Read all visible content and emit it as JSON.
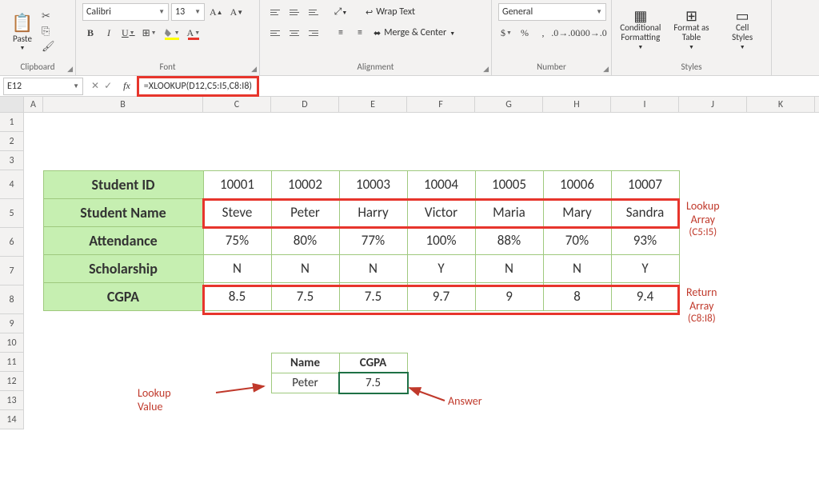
{
  "ribbon": {
    "clipboard": {
      "paste": "Paste",
      "label": "Clipboard"
    },
    "font": {
      "name": "Calibri",
      "size": "13",
      "bold": "B",
      "italic": "I",
      "underline": "U",
      "label": "Font"
    },
    "alignment": {
      "wrap": "Wrap Text",
      "merge": "Merge & Center",
      "label": "Alignment"
    },
    "number": {
      "format": "General",
      "label": "Number"
    },
    "styles": {
      "cond": "Conditional\nFormatting",
      "table": "Format as\nTable",
      "cell": "Cell\nStyles",
      "label": "Styles"
    }
  },
  "namebox": "E12",
  "formula": "=XLOOKUP(D12,C5:I5,C8:I8)",
  "columns": [
    "A",
    "B",
    "C",
    "D",
    "E",
    "F",
    "G",
    "H",
    "I",
    "J",
    "K"
  ],
  "rows": [
    "1",
    "2",
    "3",
    "4",
    "5",
    "6",
    "7",
    "8",
    "9",
    "10",
    "11",
    "12",
    "13",
    "14"
  ],
  "table": {
    "headers": [
      "Student ID",
      "Student Name",
      "Attendance",
      "Scholarship",
      "CGPA"
    ],
    "data": [
      [
        "10001",
        "10002",
        "10003",
        "10004",
        "10005",
        "10006",
        "10007"
      ],
      [
        "Steve",
        "Peter",
        "Harry",
        "Victor",
        "Maria",
        "Mary",
        "Sandra"
      ],
      [
        "75%",
        "80%",
        "77%",
        "100%",
        "88%",
        "70%",
        "93%"
      ],
      [
        "N",
        "N",
        "N",
        "Y",
        "N",
        "N",
        "Y"
      ],
      [
        "8.5",
        "7.5",
        "7.5",
        "9.7",
        "9",
        "8",
        "9.4"
      ]
    ]
  },
  "lookup": {
    "h1": "Name",
    "h2": "CGPA",
    "v1": "Peter",
    "v2": "7.5"
  },
  "annos": {
    "lookupArray": "Lookup Array",
    "lookupArrayRef": "(C5:I5)",
    "returnArray": "Return Array",
    "returnArrayRef": "(C8:I8)",
    "lookupValue": "Lookup Value",
    "answer": "Answer"
  },
  "chart_data": {
    "type": "table",
    "title": "Student records with XLOOKUP example",
    "row_headers": [
      "Student ID",
      "Student Name",
      "Attendance",
      "Scholarship",
      "CGPA"
    ],
    "columns": [
      "C",
      "D",
      "E",
      "F",
      "G",
      "H",
      "I"
    ],
    "records": [
      {
        "Student ID": "10001",
        "Student Name": "Steve",
        "Attendance": "75%",
        "Scholarship": "N",
        "CGPA": 8.5
      },
      {
        "Student ID": "10002",
        "Student Name": "Peter",
        "Attendance": "80%",
        "Scholarship": "N",
        "CGPA": 7.5
      },
      {
        "Student ID": "10003",
        "Student Name": "Harry",
        "Attendance": "77%",
        "Scholarship": "N",
        "CGPA": 7.5
      },
      {
        "Student ID": "10004",
        "Student Name": "Victor",
        "Attendance": "100%",
        "Scholarship": "Y",
        "CGPA": 9.7
      },
      {
        "Student ID": "10005",
        "Student Name": "Maria",
        "Attendance": "88%",
        "Scholarship": "N",
        "CGPA": 9
      },
      {
        "Student ID": "10006",
        "Student Name": "Mary",
        "Attendance": "70%",
        "Scholarship": "N",
        "CGPA": 8
      },
      {
        "Student ID": "10007",
        "Student Name": "Sandra",
        "Attendance": "93%",
        "Scholarship": "Y",
        "CGPA": 9.4
      }
    ],
    "formula": "=XLOOKUP(D12,C5:I5,C8:I8)",
    "lookup_value_cell": "D12",
    "lookup_array": "C5:I5",
    "return_array": "C8:I8",
    "result_cell": "E12",
    "result_value": 7.5
  }
}
